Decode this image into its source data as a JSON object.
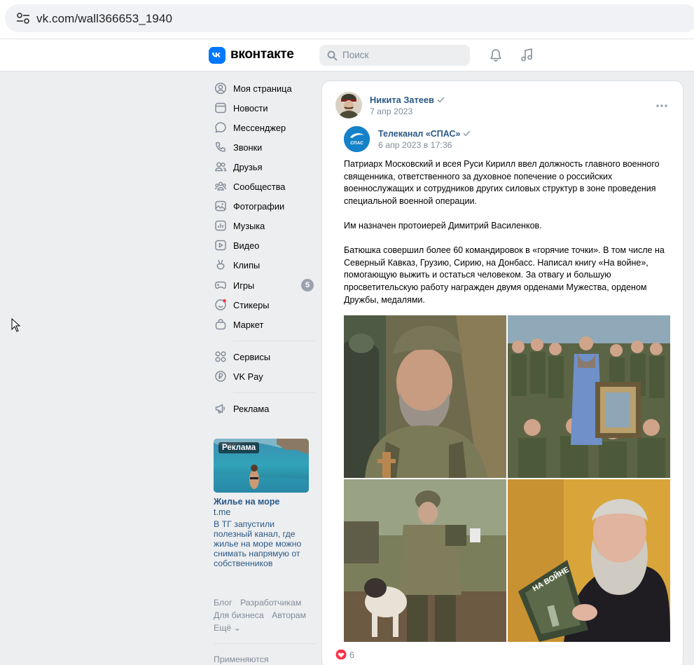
{
  "browser": {
    "url": "vk.com/wall366653_1940"
  },
  "header": {
    "logo_text": "вконтакте",
    "search_placeholder": "Поиск"
  },
  "nav": {
    "items": [
      {
        "label": "Моя страница",
        "icon": "user-circle-icon"
      },
      {
        "label": "Новости",
        "icon": "newspaper-icon"
      },
      {
        "label": "Мессенджер",
        "icon": "chat-bubble-icon"
      },
      {
        "label": "Звонки",
        "icon": "phone-icon"
      },
      {
        "label": "Друзья",
        "icon": "friends-icon"
      },
      {
        "label": "Сообщества",
        "icon": "communities-icon"
      },
      {
        "label": "Фотографии",
        "icon": "photo-icon"
      },
      {
        "label": "Музыка",
        "icon": "music-icon"
      },
      {
        "label": "Видео",
        "icon": "video-icon"
      },
      {
        "label": "Клипы",
        "icon": "clips-icon"
      },
      {
        "label": "Игры",
        "icon": "gamepad-icon",
        "badge": "5"
      },
      {
        "label": "Стикеры",
        "icon": "sticker-icon"
      },
      {
        "label": "Маркет",
        "icon": "bag-icon"
      },
      {
        "label": "Сервисы",
        "icon": "services-icon"
      },
      {
        "label": "VK Pay",
        "icon": "ruble-icon"
      },
      {
        "label": "Реклама",
        "icon": "megaphone-icon"
      }
    ]
  },
  "ad": {
    "tag": "Реклама",
    "title": "Жилье на море",
    "domain": "t.me",
    "description": "В ТГ запустили полезный канал, где жилье на море можно снимать напрямую от собственников"
  },
  "footer": {
    "links": [
      "Блог",
      "Разработчикам",
      "Для бизнеса",
      "Авторам",
      "Ещё ⌄"
    ],
    "more": "Применяются"
  },
  "post": {
    "author": "Никита Затеев",
    "date": "7 апр 2023",
    "repost": {
      "author": "Телеканал «СПАС»",
      "avatar_text": "СПАС",
      "date": "6 апр 2023 в 17:36"
    },
    "paragraphs": [
      "Патриарх Московский и всея Руси Кирилл ввел должность главного военного священника, ответственного за духовное попечение о российских военнослужащих и сотрудников других силовых структур в зоне проведения специальной военной операции.",
      "Им назначен протоиерей Димитрий Василенков.",
      "Батюшка совершил более 60 командировок в «горячие точки». В том числе на Северный Кавказ, Грузию, Сирию, на Донбасс. Написал книгу «На войне», помогающую выжить и остаться человеком. За отвагу и большую просветительскую работу награжден двумя орденами Мужества, орденом Дружбы, медалями."
    ],
    "book_title": "НА ВОЙНЕ",
    "likes": "6"
  },
  "colors": {
    "accent": "#0077ff",
    "link": "#2a5885",
    "muted": "#818c99",
    "background": "#edeef0"
  }
}
